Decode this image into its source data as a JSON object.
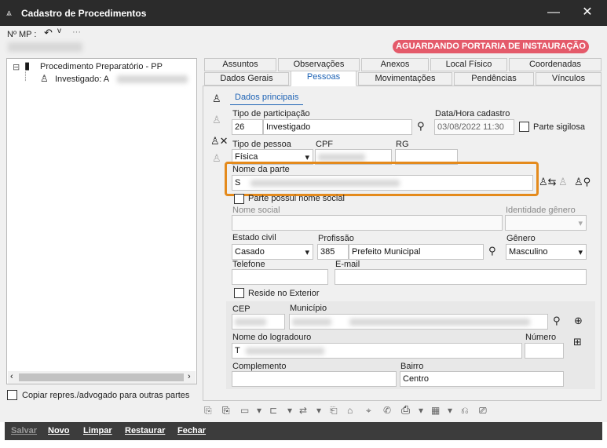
{
  "window": {
    "title": "Cadastro de Procedimentos",
    "minimize_icon": "minimize-icon",
    "close_icon": "close-icon"
  },
  "header": {
    "mp_label": "Nº MP :",
    "undo_icon": "undo-icon",
    "more": "···"
  },
  "status_badge": {
    "text": "AGUARDANDO PORTARIA DE INSTAURAÇÃO",
    "color": "#e45a6a"
  },
  "tree": {
    "root_toggle": "⊟",
    "root_label": "Procedimento Preparatório - PP",
    "child_label": "Investigado: A"
  },
  "copy_option": {
    "label": "Copiar repres./advogado para outras partes",
    "checked": false
  },
  "tabs_row1": [
    "Assuntos",
    "Observações",
    "Anexos",
    "Local Físico",
    "Coordenadas"
  ],
  "tabs_row2": [
    "Dados Gerais",
    "Pessoas",
    "Movimentações",
    "Pendências",
    "Vínculos"
  ],
  "active_tab": "Pessoas",
  "subtab": "Dados principais",
  "form": {
    "tipo_participacao": {
      "label": "Tipo de participação",
      "code": "26",
      "value": "Investigado"
    },
    "data_hora": {
      "label": "Data/Hora cadastro",
      "value": "03/08/2022 11:30"
    },
    "parte_sigilosa": {
      "label": "Parte sigilosa",
      "checked": false
    },
    "tipo_pessoa": {
      "label": "Tipo de pessoa",
      "value": "Física"
    },
    "cpf": {
      "label": "CPF"
    },
    "rg": {
      "label": "RG"
    },
    "nome_parte": {
      "label": "Nome da parte",
      "first_char": "S"
    },
    "nome_social_flag": {
      "label": "Parte possui nome social",
      "checked": false
    },
    "nome_social": {
      "label": "Nome social"
    },
    "identidade_genero": {
      "label": "Identidade gênero"
    },
    "estado_civil": {
      "label": "Estado civil",
      "value": "Casado"
    },
    "profissao": {
      "label": "Profissão",
      "code": "385",
      "value": "Prefeito Municipal"
    },
    "genero": {
      "label": "Gênero",
      "value": "Masculino"
    },
    "telefone": {
      "label": "Telefone"
    },
    "email": {
      "label": "E-mail"
    },
    "reside_exterior": {
      "label": "Reside no Exterior",
      "checked": false
    },
    "cep": {
      "label": "CEP"
    },
    "municipio": {
      "label": "Município"
    },
    "logradouro": {
      "label": "Nome do logradouro",
      "first_char": "T"
    },
    "numero": {
      "label": "Número"
    },
    "complemento": {
      "label": "Complemento"
    },
    "bairro": {
      "label": "Bairro",
      "value": "Centro"
    }
  },
  "actions": {
    "salvar": "Salvar",
    "novo": "Novo",
    "limpar": "Limpar",
    "restaurar": "Restaurar",
    "fechar": "Fechar"
  },
  "accent_color": "#e48a1c"
}
